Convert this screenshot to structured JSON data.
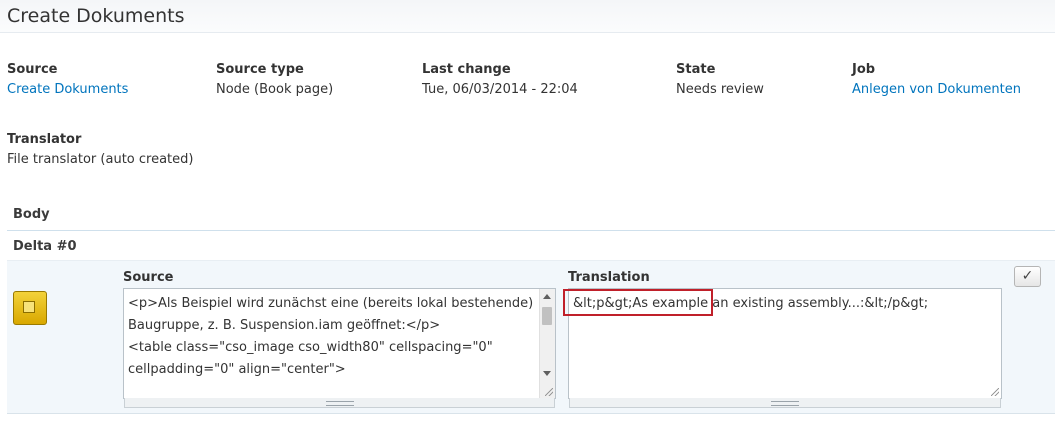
{
  "page": {
    "title": "Create Dokuments"
  },
  "meta": {
    "source": {
      "label": "Source",
      "value": "Create Dokuments"
    },
    "source_type": {
      "label": "Source type",
      "value": "Node (Book page)"
    },
    "last_change": {
      "label": "Last change",
      "value": "Tue, 06/03/2014 - 22:04"
    },
    "state": {
      "label": "State",
      "value": "Needs review"
    },
    "job": {
      "label": "Job",
      "value": "Anlegen von Dokumenten"
    },
    "translator": {
      "label": "Translator",
      "value": "File translator (auto created)"
    }
  },
  "sections": {
    "body": "Body",
    "delta": "Delta #0"
  },
  "item": {
    "source_label": "Source",
    "translation_label": "Translation",
    "source_text": "<p>Als Beispiel wird zunächst eine (bereits lokal bestehende) Baugruppe, z. B. Suspension.iam geöffnet:</p>\n<table class=\"cso_image cso_width80\" cellspacing=\"0\" cellpadding=\"0\" align=\"center\">\n<tbody>",
    "translation_text": "&lt;p&gt;As example an existing assembly...:&lt;/p&gt;",
    "check_glyph": "✓",
    "status_color": "#e0b800"
  }
}
